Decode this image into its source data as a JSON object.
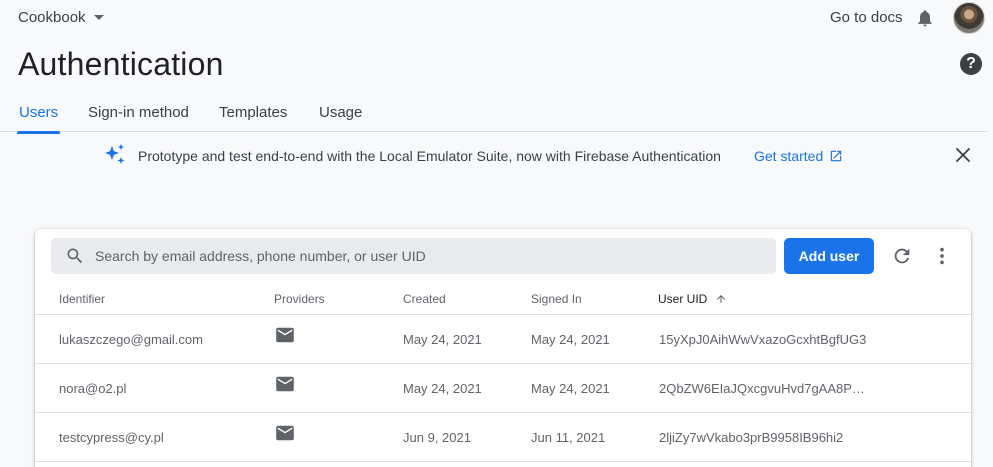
{
  "header": {
    "project_name": "Cookbook",
    "docs_link": "Go to docs",
    "page_title": "Authentication",
    "help_glyph": "?"
  },
  "tabs": [
    {
      "label": "Users",
      "active": true
    },
    {
      "label": "Sign-in method",
      "active": false
    },
    {
      "label": "Templates",
      "active": false
    },
    {
      "label": "Usage",
      "active": false
    }
  ],
  "banner": {
    "icon": "sparkle-icon",
    "text": "Prototype and test end-to-end with the Local Emulator Suite, now with Firebase Authentication",
    "link_label": "Get started"
  },
  "toolbar": {
    "search_placeholder": "Search by email address, phone number, or user UID",
    "add_user_label": "Add user"
  },
  "table": {
    "columns": [
      "Identifier",
      "Providers",
      "Created",
      "Signed In",
      "User UID"
    ],
    "sorted_column": "User UID",
    "rows": [
      {
        "identifier": "lukaszczego@gmail.com",
        "provider": "email-icon",
        "created": "May 24, 2021",
        "signed_in": "May 24, 2021",
        "uid": "15yXpJ0AihWwVxazoGcxhtBgfUG3"
      },
      {
        "identifier": "nora@o2.pl",
        "provider": "email-icon",
        "created": "May 24, 2021",
        "signed_in": "May 24, 2021",
        "uid": "2QbZW6EIaJQxcgvuHvd7gAA8PO..."
      },
      {
        "identifier": "testcypress@cy.pl",
        "provider": "email-icon",
        "created": "Jun 9, 2021",
        "signed_in": "Jun 11, 2021",
        "uid": "2ljiZy7wVkabo3prB9958IB96hi2"
      }
    ]
  },
  "colors": {
    "accent": "#1a73e8",
    "background": "#f8f9fa",
    "text_muted": "#5f6368"
  }
}
